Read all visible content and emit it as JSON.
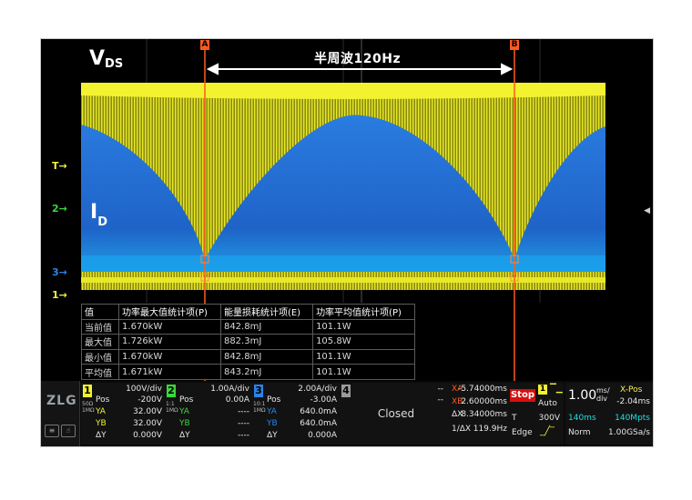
{
  "scope": {
    "trace_labels": {
      "vds_main": "V",
      "vds_sub": "DS",
      "id_main": "I",
      "id_sub": "D"
    },
    "span_label": "半周波120Hz",
    "cursor_a_tag": "A",
    "cursor_b_tag": "B",
    "markers": {
      "trigger": "T",
      "ch2": "2",
      "ch3": "3",
      "ch1": "1"
    },
    "colors": {
      "ch1": "#f2f230",
      "ch2": "#38d838",
      "ch3": "#2a84e8",
      "ch4": "#9a9a9a",
      "cursor": "#ff5a1e",
      "stop": "#d41010",
      "cyan": "#18e0e0"
    }
  },
  "stats": {
    "headers": [
      "值",
      "功率最大值统计项(P)",
      "能量损耗统计项(E)",
      "功率平均值统计项(P)"
    ],
    "rows": [
      [
        "当前值",
        "1.670kW",
        "842.8mJ",
        "101.1W"
      ],
      [
        "最大值",
        "1.726kW",
        "882.3mJ",
        "105.8W"
      ],
      [
        "最小值",
        "1.670kW",
        "842.8mJ",
        "101.1W"
      ],
      [
        "平均值",
        "1.671kW",
        "843.2mJ",
        "101.1W"
      ]
    ]
  },
  "bottom": {
    "brand": "ZLG",
    "ch1": {
      "num": "1",
      "scale": "100V/div",
      "pos_label": "Pos",
      "pos": "-200V",
      "ya_label": "YA",
      "ya": "32.00V",
      "yb_label": "YB",
      "yb": "32.00V",
      "dy_label": "ΔY",
      "dy": "0.000V",
      "side": "50Ω 1MΩ"
    },
    "ch2": {
      "num": "2",
      "scale": "1.00A/div",
      "pos_label": "Pos",
      "pos": "0.00A",
      "ya_label": "YA",
      "ya": "----",
      "yb_label": "YB",
      "yb": "----",
      "dy_label": "ΔY",
      "dy": "----",
      "side": "1:1 1MΩ"
    },
    "ch3": {
      "num": "3",
      "scale": "2.00A/div",
      "pos_label": "Pos",
      "pos": "-3.00A",
      "ya_label": "YA",
      "ya": "640.0mA",
      "yb_label": "YB",
      "yb": "640.0mA",
      "dy_label": "ΔY",
      "dy": "0.000A",
      "side": "10:1 1MΩ"
    },
    "ch4": {
      "num": "4",
      "scale": "--",
      "pos": "--",
      "button": "Closed"
    },
    "cursors": {
      "xa_label": "XA",
      "xa": "-5.74000ms",
      "xb_label": "XB",
      "xb": "2.60000ms",
      "dx_label": "ΔX",
      "dx": "8.34000ms",
      "inv_label": "1/ΔX",
      "inv": "119.9Hz"
    },
    "trigger": {
      "status": "Stop",
      "source": "1",
      "mode": "Auto",
      "type_label": "T",
      "level": "300V",
      "edge": "Edge"
    },
    "timebase": {
      "scale": "1.00",
      "unit_top": "ms/",
      "unit_bot": "div",
      "xpos_label": "X-Pos",
      "xpos": "-2.04ms",
      "window": "140ms",
      "memory": "140Mpts",
      "acq": "Norm",
      "rate": "1.00GSa/s"
    }
  }
}
